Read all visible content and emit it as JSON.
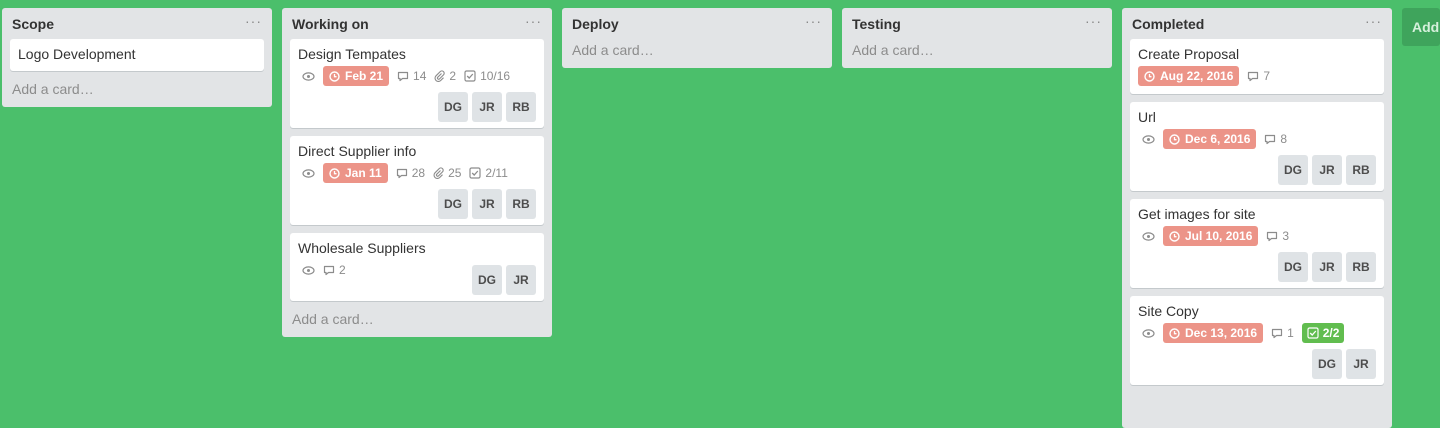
{
  "colors": {
    "background": "#4bbf6b",
    "due": "#ec9488",
    "checklist_done": "#61bd4f"
  },
  "menu_glyph": "···",
  "add_card_label": "Add a card…",
  "add_list_label": "Add a list…",
  "lists": [
    {
      "title": "Scope",
      "cards": [
        {
          "title": "Logo Development"
        }
      ]
    },
    {
      "title": "Working on",
      "cards": [
        {
          "title": "Design Tempates",
          "due": "Feb 21",
          "comments": "14",
          "attachments": "2",
          "checklist": "10/16",
          "members": [
            "DG",
            "JR",
            "RB"
          ]
        },
        {
          "title": "Direct Supplier info",
          "due": "Jan 11",
          "comments": "28",
          "attachments": "25",
          "checklist": "2/11",
          "members": [
            "DG",
            "JR",
            "RB"
          ]
        },
        {
          "title": "Wholesale Suppliers",
          "comments": "2",
          "members": [
            "DG",
            "JR"
          ]
        }
      ]
    },
    {
      "title": "Deploy",
      "cards": []
    },
    {
      "title": "Testing",
      "cards": []
    },
    {
      "title": "Completed",
      "cards": [
        {
          "title": "Create Proposal",
          "due": "Aug 22, 2016",
          "comments": "7"
        },
        {
          "title": "Url",
          "due": "Dec 6, 2016",
          "comments": "8",
          "members": [
            "DG",
            "JR",
            "RB"
          ]
        },
        {
          "title": "Get images for site",
          "due": "Jul 10, 2016",
          "comments": "3",
          "members": [
            "DG",
            "JR",
            "RB"
          ]
        },
        {
          "title": "Site Copy",
          "due": "Dec 13, 2016",
          "comments": "1",
          "checklist_done": "2/2",
          "members": [
            "DG",
            "JR"
          ]
        }
      ]
    }
  ]
}
